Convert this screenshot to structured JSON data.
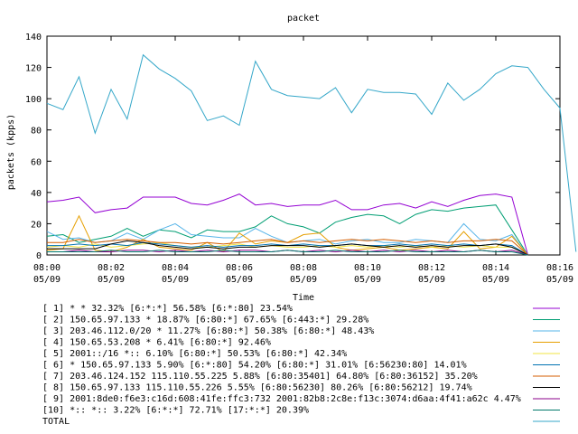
{
  "chart_data": {
    "type": "line",
    "title": "packet",
    "xlabel": "Time",
    "ylabel": "packets (kpps)",
    "ylim": [
      0,
      140
    ],
    "yticks": [
      "0",
      "20",
      "40",
      "60",
      "80",
      "100",
      "120",
      "140"
    ],
    "xticks": [
      {
        "time": "08:00",
        "date": "05/09"
      },
      {
        "time": "08:02",
        "date": "05/09"
      },
      {
        "time": "08:04",
        "date": "05/09"
      },
      {
        "time": "08:06",
        "date": "05/09"
      },
      {
        "time": "08:08",
        "date": "05/09"
      },
      {
        "time": "08:10",
        "date": "05/09"
      },
      {
        "time": "08:12",
        "date": "05/09"
      },
      {
        "time": "08:14",
        "date": "05/09"
      },
      {
        "time": "08:16",
        "date": "05/09"
      }
    ],
    "xlim_minutes": [
      0,
      16
    ],
    "grid": false,
    "legend_position": "bottom",
    "series": [
      {
        "name": "[ 1] * * 32.32%  [6:*:*] 56.58% [6:*:80] 23.54%",
        "color": "#9400d3",
        "values": [
          34,
          35,
          37,
          27,
          29,
          30,
          37,
          37,
          37,
          33,
          32,
          35,
          39,
          32,
          33,
          31,
          32,
          32,
          35,
          29,
          29,
          32,
          33,
          30,
          34,
          31,
          35,
          38,
          39,
          37,
          0
        ]
      },
      {
        "name": "[ 2] 150.65.97.133 * 18.87%  [6:80:*] 67.65% [6:443:*] 29.28%",
        "color": "#009e73",
        "values": [
          12,
          13,
          8,
          10,
          12,
          17,
          12,
          16,
          15,
          11,
          16,
          15,
          15,
          18,
          25,
          20,
          18,
          14,
          21,
          24,
          26,
          25,
          20,
          26,
          29,
          28,
          30,
          31,
          32,
          16,
          0
        ]
      },
      {
        "name": "[ 3] 203.46.112.0/20 * 11.27%  [6:80:*] 50.38% [6:80:*] 48.43%",
        "color": "#56b4e9",
        "values": [
          15,
          10,
          11,
          8,
          9,
          14,
          10,
          16,
          20,
          13,
          12,
          11,
          11,
          17,
          12,
          8,
          9,
          10,
          7,
          9,
          10,
          8,
          8,
          10,
          9,
          8,
          20,
          10,
          9,
          13,
          0
        ]
      },
      {
        "name": "[ 4] 150.65.53.208 * 6.41%  [6:80:*] 92.46%",
        "color": "#e69f00",
        "values": [
          3,
          4,
          25,
          3,
          2,
          5,
          10,
          5,
          4,
          3,
          8,
          2,
          14,
          7,
          9,
          8,
          13,
          14,
          5,
          3,
          4,
          5,
          3,
          4,
          5,
          4,
          15,
          4,
          5,
          12,
          0
        ]
      },
      {
        "name": "[ 5] 2001::/16 *:: 6.10%  [6:80:*] 50.53% [6:80:*] 42.34%",
        "color": "#f0e442",
        "values": [
          5,
          6,
          5,
          7,
          5,
          6,
          7,
          8,
          6,
          5,
          5,
          6,
          7,
          5,
          6,
          5,
          5,
          6,
          5,
          6,
          5,
          6,
          5,
          6,
          5,
          6,
          5,
          6,
          5,
          5,
          0
        ]
      },
      {
        "name": "[ 6] * 150.65.97.133 5.90%  [6:*:80] 54.20% [6:80:*] 31.01% [6:56230:80] 14.01%",
        "color": "#0072b2",
        "values": [
          6,
          6,
          7,
          6,
          7,
          6,
          8,
          7,
          6,
          5,
          6,
          5,
          6,
          6,
          7,
          6,
          7,
          6,
          6,
          7,
          6,
          6,
          7,
          6,
          7,
          6,
          7,
          6,
          7,
          6,
          0
        ]
      },
      {
        "name": "[ 7] 203.46.124.152 115.110.55.225 5.88%  [6:80:35401] 64.80% [6:80:36152] 35.20%",
        "color": "#d55e00",
        "values": [
          8,
          8,
          10,
          8,
          9,
          10,
          9,
          8,
          8,
          7,
          8,
          7,
          8,
          9,
          10,
          8,
          9,
          8,
          9,
          10,
          9,
          10,
          9,
          8,
          9,
          8,
          9,
          9,
          10,
          9,
          0
        ]
      },
      {
        "name": "[ 8] 150.65.97.133 115.110.55.226 5.55%  [6:80:56230] 80.26% [6:80:56212] 19.74%",
        "color": "#000000",
        "values": [
          4,
          4,
          4,
          4,
          7,
          9,
          8,
          6,
          5,
          4,
          5,
          4,
          5,
          5,
          6,
          6,
          6,
          5,
          6,
          7,
          6,
          5,
          6,
          5,
          6,
          5,
          6,
          6,
          7,
          5,
          0
        ]
      },
      {
        "name": "[ 9] 2001:8de0:f6e3:c16d:608:41fe:ffc3:732 2001:82b8:2c8e:f13c:3074:d6aa:4f41:a62c 4.47%",
        "color": "#8b008b",
        "values": [
          2,
          2,
          3,
          2,
          2,
          3,
          3,
          2,
          3,
          2,
          3,
          2,
          3,
          3,
          2,
          3,
          2,
          3,
          2,
          3,
          2,
          3,
          2,
          3,
          2,
          3,
          2,
          3,
          2,
          3,
          0
        ]
      },
      {
        "name": "[10] *:: *:: 3.22%  [6:*:*] 72.71% [17:*:*] 20.39%",
        "color": "#00796b",
        "values": [
          2,
          2,
          2,
          2,
          3,
          2,
          2,
          3,
          2,
          2,
          2,
          3,
          2,
          2,
          2,
          3,
          2,
          2,
          3,
          2,
          2,
          2,
          3,
          2,
          2,
          2,
          2,
          3,
          2,
          2,
          0
        ]
      },
      {
        "name": "TOTAL",
        "color": "#35a7c9",
        "values": [
          97,
          93,
          114,
          78,
          106,
          87,
          128,
          119,
          113,
          105,
          86,
          89,
          83,
          124,
          106,
          102,
          101,
          100,
          107,
          91,
          106,
          104,
          104,
          103,
          90,
          110,
          99,
          106,
          116,
          121,
          120,
          106,
          94,
          2
        ]
      }
    ]
  }
}
